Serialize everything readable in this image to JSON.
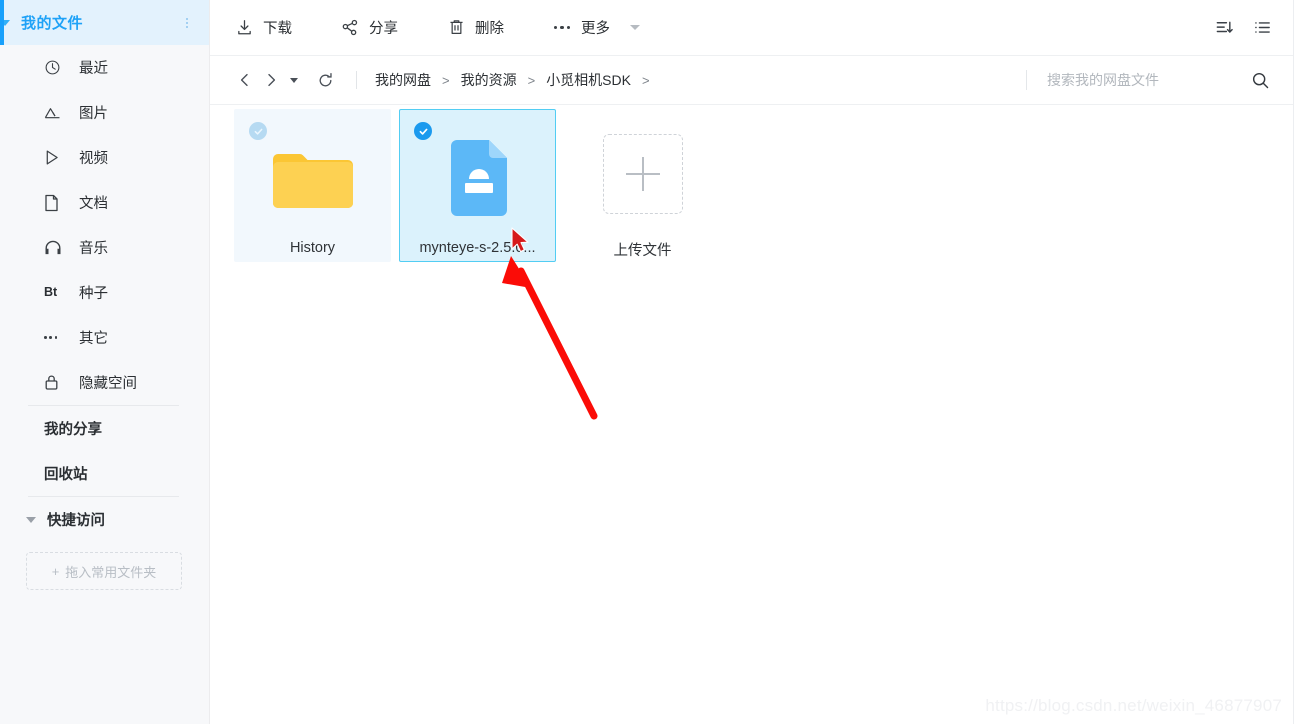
{
  "sidebar": {
    "root": {
      "label": "我的文件",
      "caret_icon": "triangle-down-icon",
      "more_icon": "dots-vertical-icon"
    },
    "items": [
      {
        "label": "最近",
        "icon": "clock-icon"
      },
      {
        "label": "图片",
        "icon": "image-mountain-icon"
      },
      {
        "label": "视频",
        "icon": "play-triangle-icon"
      },
      {
        "label": "文档",
        "icon": "document-icon"
      },
      {
        "label": "音乐",
        "icon": "headphones-icon"
      },
      {
        "label": "种子",
        "icon": "bt-text-icon"
      },
      {
        "label": "其它",
        "icon": "dots-horizontal-icon"
      },
      {
        "label": "隐藏空间",
        "icon": "lock-icon"
      }
    ],
    "plain_items": [
      {
        "label": "我的分享"
      },
      {
        "label": "回收站"
      }
    ],
    "group": {
      "label": "快捷访问",
      "caret_icon": "triangle-down-icon"
    },
    "dropzone": {
      "plus": "+",
      "label": "拖入常用文件夹"
    }
  },
  "toolbar": {
    "buttons": [
      {
        "label": "下载",
        "icon": "download-icon"
      },
      {
        "label": "分享",
        "icon": "share-nodes-icon"
      },
      {
        "label": "删除",
        "icon": "trash-icon"
      },
      {
        "label": "更多",
        "icon": "dots-horizontal-icon"
      }
    ],
    "more_caret_icon": "triangle-down-icon",
    "sort_icon": "sort-descending-icon",
    "view_icon": "list-view-icon"
  },
  "crumbbar": {
    "back_icon": "chevron-left-icon",
    "forward_icon": "chevron-right-icon",
    "history_caret_icon": "triangle-down-icon",
    "refresh_icon": "refresh-icon",
    "crumbs": [
      "我的网盘",
      "我的资源",
      "小觅相机SDK"
    ],
    "separator": ">",
    "trailing_separator": ">"
  },
  "search": {
    "placeholder": "搜索我的网盘文件",
    "value": "",
    "icon": "search-icon"
  },
  "files": [
    {
      "name": "History",
      "type": "folder",
      "icon": "folder-icon",
      "selected": false,
      "hovered": true,
      "check_state": "off"
    },
    {
      "name": "mynteye-s-2.5.0...",
      "type": "archive",
      "icon": "archive-file-icon",
      "selected": true,
      "hovered": false,
      "check_state": "on"
    }
  ],
  "upload": {
    "label": "上传文件",
    "plus_icon": "plus-icon"
  },
  "annotation": {
    "arrow_color": "#fb0c07",
    "cursor_icon": "mouse-pointer-icon"
  },
  "watermark": {
    "text": "https://blog.csdn.net/weixin_46877907"
  },
  "colors": {
    "accent": "#18a0fb",
    "active_bg": "#e3f2fd",
    "selected_bg": "#dbf2fc",
    "selected_border": "#52cdf3",
    "sidebar_bg": "#f7f8fa",
    "folder": "#fcc93f",
    "file_blue": "#5cb8f7",
    "arrow_red": "#fb0c07"
  }
}
